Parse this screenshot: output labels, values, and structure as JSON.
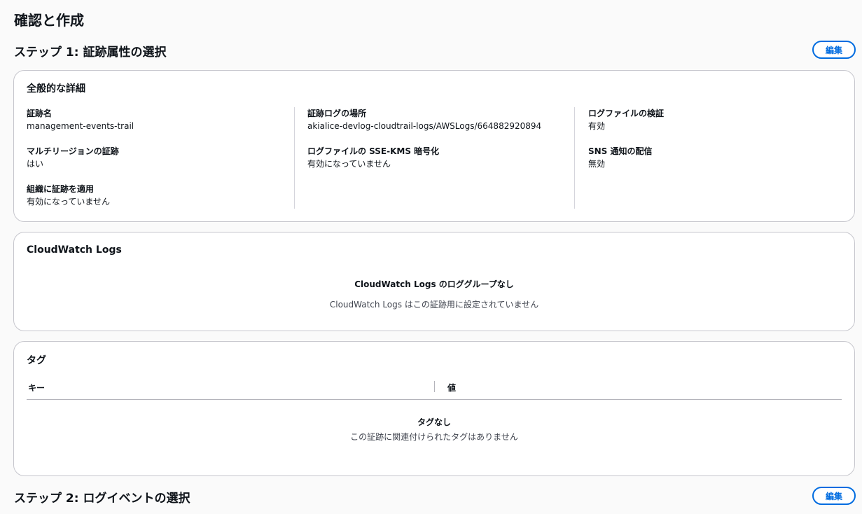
{
  "page": {
    "title": "確認と作成"
  },
  "step1": {
    "heading": "ステップ 1: 証跡属性の選択",
    "edit_label": "編集",
    "general": {
      "title": "全般的な詳細",
      "trail_name_label": "証跡名",
      "trail_name_value": "management-events-trail",
      "multi_region_label": "マルチリージョンの証跡",
      "multi_region_value": "はい",
      "org_trail_label": "組織に証跡を適用",
      "org_trail_value": "有効になっていません",
      "log_location_label": "証跡ログの場所",
      "log_location_value": "akialice-devlog-cloudtrail-logs/AWSLogs/664882920894",
      "sse_kms_label": "ログファイルの SSE-KMS 暗号化",
      "sse_kms_value": "有効になっていません",
      "validation_label": "ログファイルの検証",
      "validation_value": "有効",
      "sns_label": "SNS 通知の配信",
      "sns_value": "無効"
    },
    "cloudwatch": {
      "title": "CloudWatch Logs",
      "empty_title": "CloudWatch Logs のロググループなし",
      "empty_sub": "CloudWatch Logs はこの証跡用に設定されていません"
    },
    "tags": {
      "title": "タグ",
      "col_key": "キー",
      "col_value": "値",
      "empty_title": "タグなし",
      "empty_sub": "この証跡に関連付けられたタグはありません"
    }
  },
  "step2": {
    "heading": "ステップ 2: ログイベントの選択",
    "edit_label": "編集"
  }
}
